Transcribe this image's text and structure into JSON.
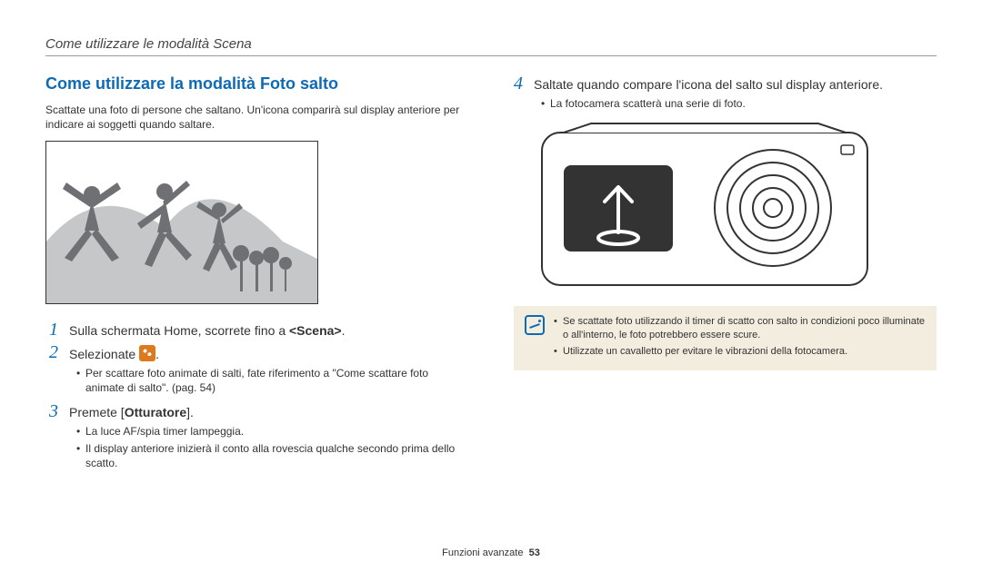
{
  "header": {
    "title": "Come utilizzare le modalità Scena"
  },
  "leftCol": {
    "heading": "Come utilizzare la modalità Foto salto",
    "intro": "Scattate una foto di persone che saltano. Un'icona comparirà sul display anteriore per indicare ai soggetti quando saltare.",
    "step1": {
      "num": "1",
      "text_a": "Sulla schermata Home, scorrete fino a ",
      "text_bold": "<Scena>",
      "text_b": "."
    },
    "step2": {
      "num": "2",
      "text_a": "Selezionate ",
      "text_b": "."
    },
    "step2_bullets": [
      "Per scattare foto animate di salti, fate riferimento a \"Come scattare foto animate di salto\". (pag. 54)"
    ],
    "step3": {
      "num": "3",
      "text_a": "Premete [",
      "text_bold": "Otturatore",
      "text_b": "]."
    },
    "step3_bullets": [
      "La luce AF/spia timer lampeggia.",
      "Il display anteriore inizierà il conto alla rovescia qualche secondo prima dello scatto."
    ]
  },
  "rightCol": {
    "step4": {
      "num": "4",
      "text": "Saltate quando compare l'icona del salto sul display anteriore."
    },
    "step4_bullets": [
      "La fotocamera scatterà una serie di foto."
    ],
    "note_bullets": [
      "Se scattate foto utilizzando il timer di scatto con salto in condizioni poco illuminate o all'interno, le foto potrebbero essere scure.",
      "Utilizzate un cavalletto per evitare le vibrazioni della fotocamera."
    ]
  },
  "footer": {
    "label": "Funzioni avanzate",
    "page": "53"
  }
}
